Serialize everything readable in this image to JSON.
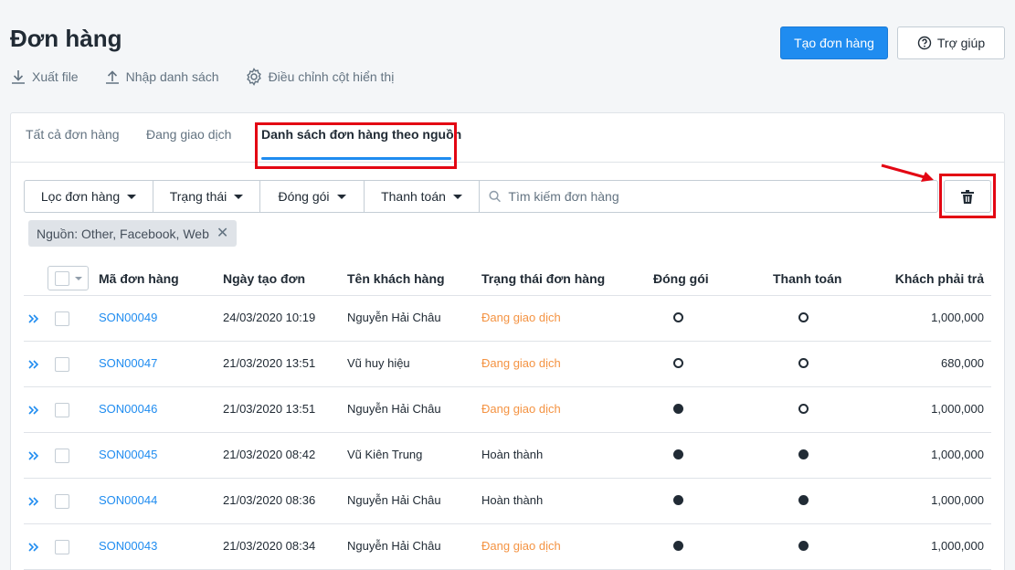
{
  "page": {
    "title": "Đơn hàng"
  },
  "actions": [
    {
      "label": "Xuất file",
      "icon": "download-icon"
    },
    {
      "label": "Nhập danh sách",
      "icon": "upload-icon"
    },
    {
      "label": "Điều chỉnh cột hiển thị",
      "icon": "gear-icon"
    }
  ],
  "header_buttons": {
    "create": "Tạo đơn hàng",
    "help": "Trợ giúp"
  },
  "tabs": [
    {
      "label": "Tất cả đơn hàng",
      "active": false
    },
    {
      "label": "Đang giao dịch",
      "active": false
    },
    {
      "label": "Danh sách đơn hàng theo nguồn",
      "active": true
    }
  ],
  "filters": [
    {
      "label": "Lọc đơn hàng"
    },
    {
      "label": "Trạng thái"
    },
    {
      "label": "Đóng gói"
    },
    {
      "label": "Thanh toán"
    }
  ],
  "search": {
    "placeholder": "Tìm kiếm đơn hàng",
    "value": ""
  },
  "chip": {
    "label": "Nguồn: Other, Facebook, Web"
  },
  "table": {
    "columns": [
      "Mã đơn hàng",
      "Ngày tạo đơn",
      "Tên khách hàng",
      "Trạng thái đơn hàng",
      "Đóng gói",
      "Thanh toán",
      "Khách phải trả"
    ],
    "rows": [
      {
        "code": "SON00049",
        "date": "24/03/2020 10:19",
        "customer": "Nguyễn Hải Châu",
        "status": "Đang giao dịch",
        "status_type": "pending",
        "packed": false,
        "paid": false,
        "amount": "1,000,000"
      },
      {
        "code": "SON00047",
        "date": "21/03/2020 13:51",
        "customer": "Vũ huy hiệu",
        "status": "Đang giao dịch",
        "status_type": "pending",
        "packed": false,
        "paid": false,
        "amount": "680,000"
      },
      {
        "code": "SON00046",
        "date": "21/03/2020 13:51",
        "customer": "Nguyễn Hải Châu",
        "status": "Đang giao dịch",
        "status_type": "pending",
        "packed": true,
        "paid": false,
        "amount": "1,000,000"
      },
      {
        "code": "SON00045",
        "date": "21/03/2020 08:42",
        "customer": "Vũ Kiên Trung",
        "status": "Hoàn thành",
        "status_type": "done",
        "packed": true,
        "paid": true,
        "amount": "1,000,000"
      },
      {
        "code": "SON00044",
        "date": "21/03/2020 08:36",
        "customer": "Nguyễn Hải Châu",
        "status": "Hoàn thành",
        "status_type": "done",
        "packed": true,
        "paid": true,
        "amount": "1,000,000"
      },
      {
        "code": "SON00043",
        "date": "21/03/2020 08:34",
        "customer": "Nguyễn Hải Châu",
        "status": "Đang giao dịch",
        "status_type": "pending",
        "packed": true,
        "paid": true,
        "amount": "1,000,000"
      }
    ]
  },
  "colors": {
    "primary": "#1f8cf0",
    "pending": "#f49342",
    "highlight": "#e30613"
  }
}
